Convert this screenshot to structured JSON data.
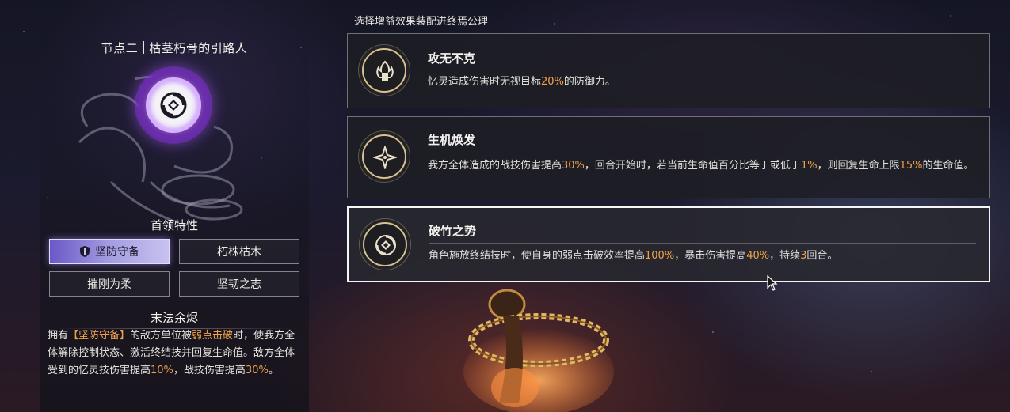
{
  "node": {
    "title_part1": "节点二",
    "title_part2": "枯茎朽骨的引路人"
  },
  "traits": {
    "heading": "首领特性",
    "items": [
      {
        "label": "坚防守备",
        "active": true
      },
      {
        "label": "朽株枯木",
        "active": false
      },
      {
        "label": "摧刚为柔",
        "active": false
      },
      {
        "label": "坚韧之志",
        "active": false
      }
    ]
  },
  "finale": {
    "heading": "末法余烬",
    "segments": [
      {
        "text": "拥有",
        "hl": false
      },
      {
        "text": "【坚防守备】",
        "hl": true
      },
      {
        "text": "的敌方单位被",
        "hl": false
      },
      {
        "text": "弱点击破",
        "hl": true
      },
      {
        "text": "时，使我方全体解除控制状态、激活终结技并回复生命值。敌方全体受到的忆灵技伤害提高",
        "hl": false
      },
      {
        "text": "10%",
        "hl": true
      },
      {
        "text": "，战技伤害提高",
        "hl": false
      },
      {
        "text": "30%",
        "hl": true
      },
      {
        "text": "。",
        "hl": false
      }
    ]
  },
  "instruction": "选择增益效果装配进终焉公理",
  "buffs": [
    {
      "title": "攻无不克",
      "icon": "fist-flame-icon",
      "selected": false,
      "segments": [
        {
          "text": "忆灵造成伤害时无视目标",
          "hl": false
        },
        {
          "text": "20%",
          "hl": true
        },
        {
          "text": "的防御力。",
          "hl": false
        }
      ]
    },
    {
      "title": "生机焕发",
      "icon": "star-sparkle-icon",
      "selected": false,
      "segments": [
        {
          "text": "我方全体造成的战技伤害提高",
          "hl": false
        },
        {
          "text": "30%",
          "hl": true
        },
        {
          "text": "，回合开始时，若当前生命值百分比等于或低于",
          "hl": false
        },
        {
          "text": "1%",
          "hl": true
        },
        {
          "text": "，则回复生命上限",
          "hl": false
        },
        {
          "text": "15%",
          "hl": true
        },
        {
          "text": "的生命值。",
          "hl": false
        }
      ]
    },
    {
      "title": "破竹之势",
      "icon": "break-cycle-icon",
      "selected": true,
      "segments": [
        {
          "text": "角色施放终结技时，使自身的弱点击破效率提高",
          "hl": false
        },
        {
          "text": "100%",
          "hl": true
        },
        {
          "text": "，暴击伤害提高",
          "hl": false
        },
        {
          "text": "40%",
          "hl": true
        },
        {
          "text": "，持续",
          "hl": false
        },
        {
          "text": "3",
          "hl": true
        },
        {
          "text": "回合。",
          "hl": false
        }
      ]
    }
  ],
  "colors": {
    "highlight": "#f0a24a",
    "active_trait": "#a39ce0",
    "node_glow": "#b070ff",
    "emblem_gold": "#d6c290"
  }
}
